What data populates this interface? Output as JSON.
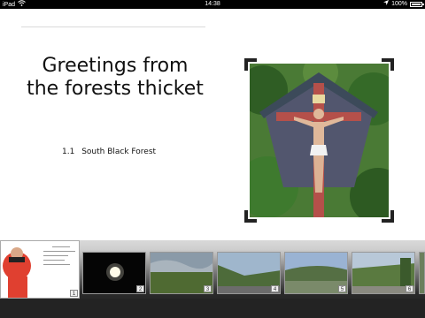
{
  "status_bar": {
    "device": "iPad",
    "time": "14:38",
    "battery": "100%",
    "battery_level": 1.0
  },
  "slide": {
    "title_line1": "Greetings from",
    "title_line2": "the forests thicket",
    "subtitle_number": "1.1",
    "subtitle_text": "South Black Forest"
  },
  "thumbnails": [
    {
      "number": "1",
      "active": true
    },
    {
      "number": "2",
      "active": false
    },
    {
      "number": "3",
      "active": false
    },
    {
      "number": "4",
      "active": false
    },
    {
      "number": "5",
      "active": false
    },
    {
      "number": "6",
      "active": false
    }
  ],
  "colors": {
    "status_bar_bg": "#000000",
    "strip_dark": "#232323",
    "cross_wood": "#b5504a",
    "forest_green": "#3b6a2d"
  }
}
